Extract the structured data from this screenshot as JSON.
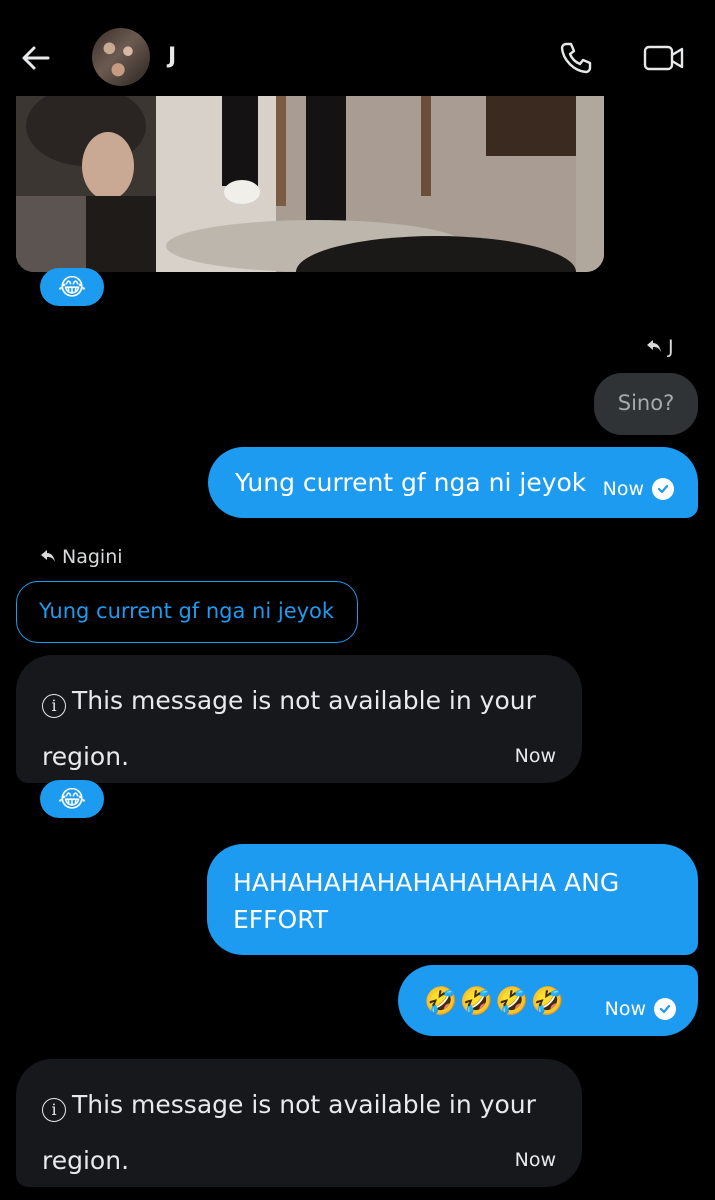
{
  "header": {
    "contact_name": "J",
    "back_icon": "arrow-left-icon",
    "call_icon": "phone-icon",
    "video_icon": "video-camera-icon"
  },
  "colors": {
    "accent": "#1d9bf0",
    "incoming_bubble": "#16181c",
    "background": "#000000"
  },
  "messages": [
    {
      "reaction": "😂"
    },
    {
      "reply_to": "J",
      "quoted_text": "Sino?",
      "text": "Yung current gf nga ni jeyok",
      "time": "Now",
      "status": "read"
    },
    {
      "reply_to": "Nagini",
      "quoted_text": "Yung current gf nga ni jeyok",
      "info_symbol": "i",
      "text": "This message is not available in your region.",
      "time": "Now",
      "reaction": "😂"
    },
    {
      "text": "HAHAHAHAHAHAHAHAHA ANG EFFORT"
    },
    {
      "text": "🤣🤣🤣🤣",
      "time": "Now",
      "status": "read"
    },
    {
      "info_symbol": "i",
      "text": "This message is not available in your region.",
      "time": "Now"
    }
  ]
}
